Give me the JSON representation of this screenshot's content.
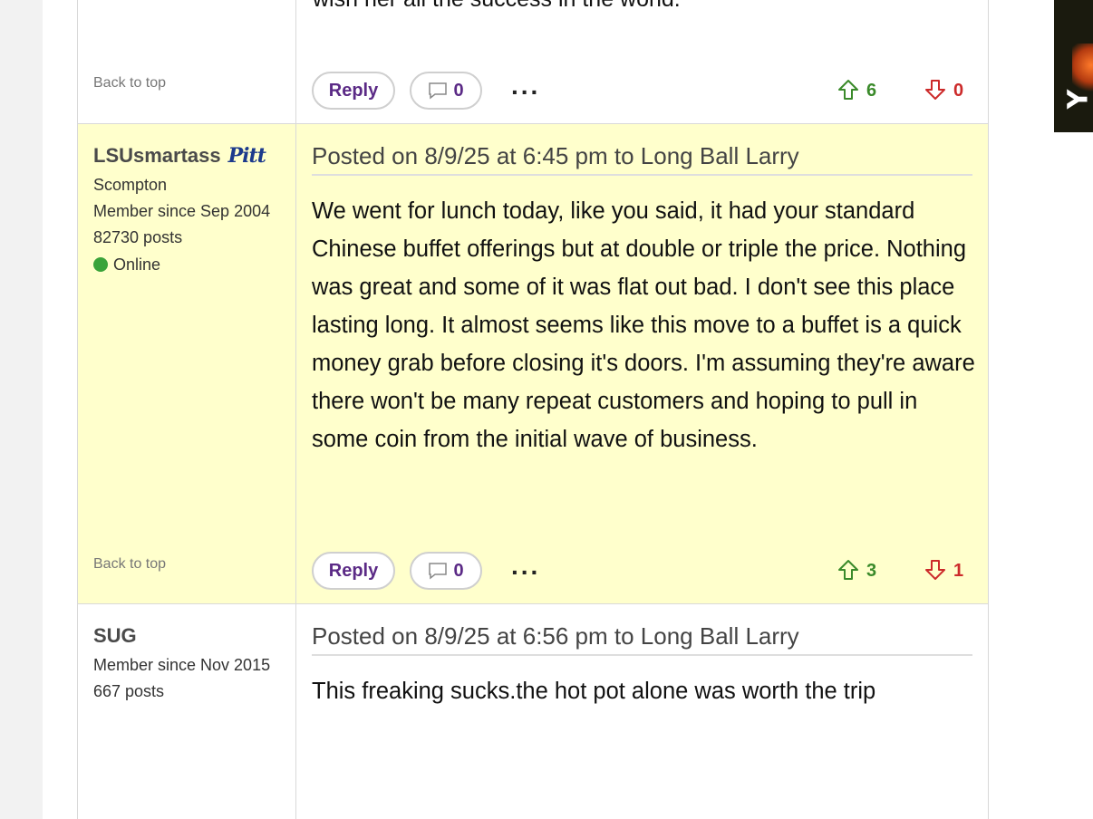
{
  "previous_post": {
    "cut_text": "wish her all the success in the world.",
    "back_to_top": "Back to top",
    "reply_label": "Reply",
    "comment_count": "0",
    "more_label": "...",
    "upvotes": "6",
    "downvotes": "0"
  },
  "post_highlighted": {
    "username": "LSUsmartass",
    "team_logo": "Pitt",
    "location": "Scompton",
    "member_since": "Member since Sep 2004",
    "posts": "82730 posts",
    "status": "Online",
    "header": "Posted on 8/9/25 at 6:45 pm to Long Ball Larry",
    "body": "We went for lunch today, like you said, it had your standard Chinese buffet offerings but at double or triple the price. Nothing was great and some of it was flat out bad. I don't see this place lasting long. It almost seems like this move to a buffet is a quick money grab before closing it's doors. I'm assuming they're aware there won't be many repeat customers and hoping to pull in some coin from the initial wave of business.",
    "back_to_top": "Back to top",
    "reply_label": "Reply",
    "comment_count": "0",
    "more_label": "...",
    "upvotes": "3",
    "downvotes": "1"
  },
  "post_last": {
    "username": "SUG",
    "member_since": "Member since Nov 2015",
    "posts": "667 posts",
    "header": "Posted on 8/9/25 at 6:56 pm to Long Ball Larry",
    "body": "This freaking sucks.the hot pot alone was worth the trip"
  },
  "side_ad": {
    "letter": "Y"
  },
  "colors": {
    "highlight_bg": "#ffffcc",
    "upvote": "#3a8a2a",
    "downvote": "#cc2a2a",
    "button_text": "#5b2a86",
    "online": "#3aa33a"
  },
  "icons": {
    "comment": "speech-bubble-icon",
    "upvote": "arrow-up-outline-icon",
    "downvote": "arrow-down-outline-icon",
    "online": "green-dot-icon"
  }
}
